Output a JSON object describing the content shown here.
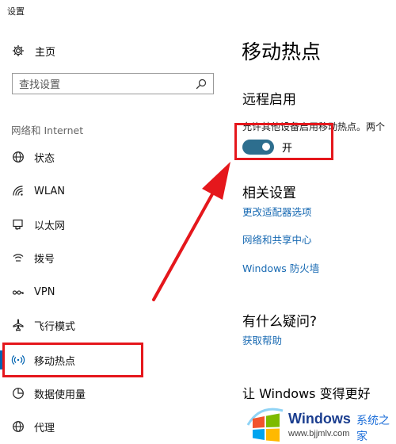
{
  "window": {
    "title": "设置"
  },
  "sidebar": {
    "home": {
      "label": "主页",
      "icon": "gear-icon"
    },
    "search": {
      "placeholder": "查找设置",
      "icon": "search-icon"
    },
    "section_label": "网络和 Internet",
    "items": [
      {
        "label": "状态",
        "icon": "globe-icon",
        "active": false
      },
      {
        "label": "WLAN",
        "icon": "wifi-icon",
        "active": false
      },
      {
        "label": "以太网",
        "icon": "ethernet-icon",
        "active": false
      },
      {
        "label": "拨号",
        "icon": "dialup-icon",
        "active": false
      },
      {
        "label": "VPN",
        "icon": "vpn-icon",
        "active": false
      },
      {
        "label": "飞行模式",
        "icon": "airplane-icon",
        "active": false
      },
      {
        "label": "移动热点",
        "icon": "hotspot-icon",
        "active": true
      },
      {
        "label": "数据使用量",
        "icon": "data-usage-icon",
        "active": false
      },
      {
        "label": "代理",
        "icon": "globe-icon",
        "active": false
      }
    ]
  },
  "main": {
    "title": "移动热点",
    "remote": {
      "heading": "远程启用",
      "description": "允许其他设备启用移动热点。两个",
      "toggle": {
        "state": "开",
        "on": true
      }
    },
    "related": {
      "heading": "相关设置",
      "links": [
        "更改适配器选项",
        "网络和共享中心",
        "Windows 防火墙"
      ]
    },
    "question": {
      "heading": "有什么疑问?",
      "link": "获取帮助"
    },
    "better": {
      "heading": "让 Windows 变得更好"
    }
  },
  "watermark": {
    "brand": "Windows",
    "site": "系统之家",
    "url": "www.bjjmlv.com"
  },
  "colors": {
    "accent": "#0063b1",
    "toggle_on": "#2d6e8e",
    "link": "#1a6bb3",
    "highlight": "#e5171c"
  }
}
